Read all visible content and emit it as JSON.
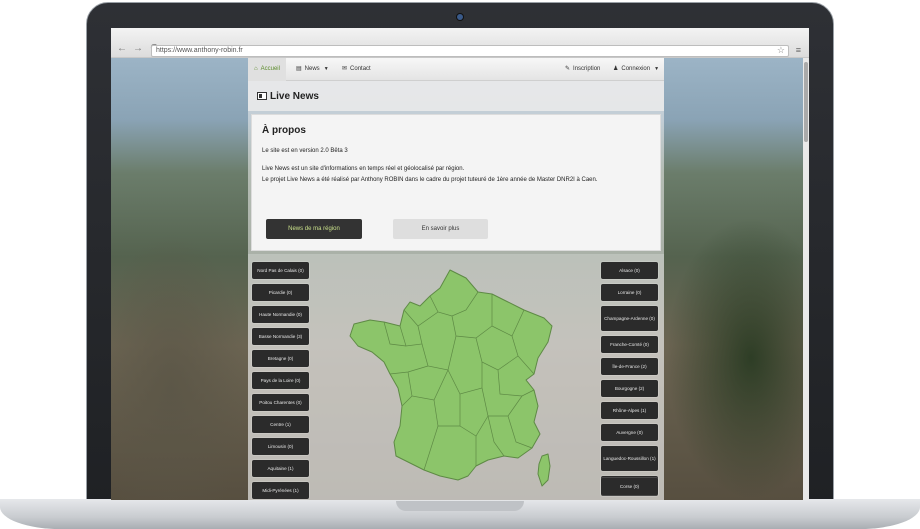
{
  "browser": {
    "url": "https://www.anthony-robin.fr",
    "back": "←",
    "forward": "→",
    "reload": "C",
    "star": "☆",
    "menu": "≡"
  },
  "site_nav": {
    "home": "Accueil",
    "news": "News",
    "contact": "Contact",
    "register": "Inscription",
    "login": "Connexion"
  },
  "news_title": "Live News",
  "about": {
    "title": "À propos",
    "version": "Le site est en version 2.0 Bêta 3",
    "line1": "Live News est un site d'informations en temps réel et géolocalisé par région.",
    "line2": "Le projet Live News a été réalisé par Anthony ROBIN dans le cadre du projet tuteuré de 1ère année de Master DNR2I à Caen.",
    "btn_region": "News de ma région",
    "btn_more": "En savoir plus"
  },
  "regions_left": [
    "Nord Pas de Calais (0)",
    "Picardie (0)",
    "Haute Normandie (0)",
    "Basse Normandie (3)",
    "Bretagne (0)",
    "Pays de la Loire (0)",
    "Poitou Charentes (0)",
    "Centre (1)",
    "Limousin (0)",
    "Aquitaine (1)",
    "Midi-Pyrénées (1)"
  ],
  "regions_right": [
    "Alsace (0)",
    "Lorraine (0)",
    "Champagne-Ardenne (0)",
    "Franche-Comté (0)",
    "Île-de-France (2)",
    "Bourgogne (2)",
    "Rhône-Alpes (1)",
    "Auvergne (0)",
    "Languedoc-Roussillon (1)",
    "Provence-Alpes-Côte d'Azur (0)",
    "Corse (0)"
  ],
  "colors": {
    "accent_green": "#8cc56a",
    "map_stroke": "#5e8a45",
    "dark_button": "#2b2b2b",
    "button_text_green": "#c9e08a"
  }
}
